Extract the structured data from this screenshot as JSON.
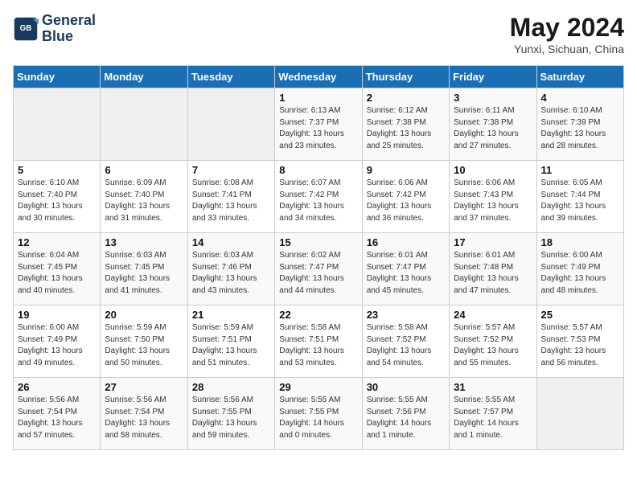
{
  "header": {
    "logo_line1": "General",
    "logo_line2": "Blue",
    "month_year": "May 2024",
    "location": "Yunxi, Sichuan, China"
  },
  "days_of_week": [
    "Sunday",
    "Monday",
    "Tuesday",
    "Wednesday",
    "Thursday",
    "Friday",
    "Saturday"
  ],
  "weeks": [
    [
      {
        "day": "",
        "info": ""
      },
      {
        "day": "",
        "info": ""
      },
      {
        "day": "",
        "info": ""
      },
      {
        "day": "1",
        "info": "Sunrise: 6:13 AM\nSunset: 7:37 PM\nDaylight: 13 hours\nand 23 minutes."
      },
      {
        "day": "2",
        "info": "Sunrise: 6:12 AM\nSunset: 7:38 PM\nDaylight: 13 hours\nand 25 minutes."
      },
      {
        "day": "3",
        "info": "Sunrise: 6:11 AM\nSunset: 7:38 PM\nDaylight: 13 hours\nand 27 minutes."
      },
      {
        "day": "4",
        "info": "Sunrise: 6:10 AM\nSunset: 7:39 PM\nDaylight: 13 hours\nand 28 minutes."
      }
    ],
    [
      {
        "day": "5",
        "info": "Sunrise: 6:10 AM\nSunset: 7:40 PM\nDaylight: 13 hours\nand 30 minutes."
      },
      {
        "day": "6",
        "info": "Sunrise: 6:09 AM\nSunset: 7:40 PM\nDaylight: 13 hours\nand 31 minutes."
      },
      {
        "day": "7",
        "info": "Sunrise: 6:08 AM\nSunset: 7:41 PM\nDaylight: 13 hours\nand 33 minutes."
      },
      {
        "day": "8",
        "info": "Sunrise: 6:07 AM\nSunset: 7:42 PM\nDaylight: 13 hours\nand 34 minutes."
      },
      {
        "day": "9",
        "info": "Sunrise: 6:06 AM\nSunset: 7:42 PM\nDaylight: 13 hours\nand 36 minutes."
      },
      {
        "day": "10",
        "info": "Sunrise: 6:06 AM\nSunset: 7:43 PM\nDaylight: 13 hours\nand 37 minutes."
      },
      {
        "day": "11",
        "info": "Sunrise: 6:05 AM\nSunset: 7:44 PM\nDaylight: 13 hours\nand 39 minutes."
      }
    ],
    [
      {
        "day": "12",
        "info": "Sunrise: 6:04 AM\nSunset: 7:45 PM\nDaylight: 13 hours\nand 40 minutes."
      },
      {
        "day": "13",
        "info": "Sunrise: 6:03 AM\nSunset: 7:45 PM\nDaylight: 13 hours\nand 41 minutes."
      },
      {
        "day": "14",
        "info": "Sunrise: 6:03 AM\nSunset: 7:46 PM\nDaylight: 13 hours\nand 43 minutes."
      },
      {
        "day": "15",
        "info": "Sunrise: 6:02 AM\nSunset: 7:47 PM\nDaylight: 13 hours\nand 44 minutes."
      },
      {
        "day": "16",
        "info": "Sunrise: 6:01 AM\nSunset: 7:47 PM\nDaylight: 13 hours\nand 45 minutes."
      },
      {
        "day": "17",
        "info": "Sunrise: 6:01 AM\nSunset: 7:48 PM\nDaylight: 13 hours\nand 47 minutes."
      },
      {
        "day": "18",
        "info": "Sunrise: 6:00 AM\nSunset: 7:49 PM\nDaylight: 13 hours\nand 48 minutes."
      }
    ],
    [
      {
        "day": "19",
        "info": "Sunrise: 6:00 AM\nSunset: 7:49 PM\nDaylight: 13 hours\nand 49 minutes."
      },
      {
        "day": "20",
        "info": "Sunrise: 5:59 AM\nSunset: 7:50 PM\nDaylight: 13 hours\nand 50 minutes."
      },
      {
        "day": "21",
        "info": "Sunrise: 5:59 AM\nSunset: 7:51 PM\nDaylight: 13 hours\nand 51 minutes."
      },
      {
        "day": "22",
        "info": "Sunrise: 5:58 AM\nSunset: 7:51 PM\nDaylight: 13 hours\nand 53 minutes."
      },
      {
        "day": "23",
        "info": "Sunrise: 5:58 AM\nSunset: 7:52 PM\nDaylight: 13 hours\nand 54 minutes."
      },
      {
        "day": "24",
        "info": "Sunrise: 5:57 AM\nSunset: 7:52 PM\nDaylight: 13 hours\nand 55 minutes."
      },
      {
        "day": "25",
        "info": "Sunrise: 5:57 AM\nSunset: 7:53 PM\nDaylight: 13 hours\nand 56 minutes."
      }
    ],
    [
      {
        "day": "26",
        "info": "Sunrise: 5:56 AM\nSunset: 7:54 PM\nDaylight: 13 hours\nand 57 minutes."
      },
      {
        "day": "27",
        "info": "Sunrise: 5:56 AM\nSunset: 7:54 PM\nDaylight: 13 hours\nand 58 minutes."
      },
      {
        "day": "28",
        "info": "Sunrise: 5:56 AM\nSunset: 7:55 PM\nDaylight: 13 hours\nand 59 minutes."
      },
      {
        "day": "29",
        "info": "Sunrise: 5:55 AM\nSunset: 7:55 PM\nDaylight: 14 hours\nand 0 minutes."
      },
      {
        "day": "30",
        "info": "Sunrise: 5:55 AM\nSunset: 7:56 PM\nDaylight: 14 hours\nand 1 minute."
      },
      {
        "day": "31",
        "info": "Sunrise: 5:55 AM\nSunset: 7:57 PM\nDaylight: 14 hours\nand 1 minute."
      },
      {
        "day": "",
        "info": ""
      }
    ]
  ]
}
